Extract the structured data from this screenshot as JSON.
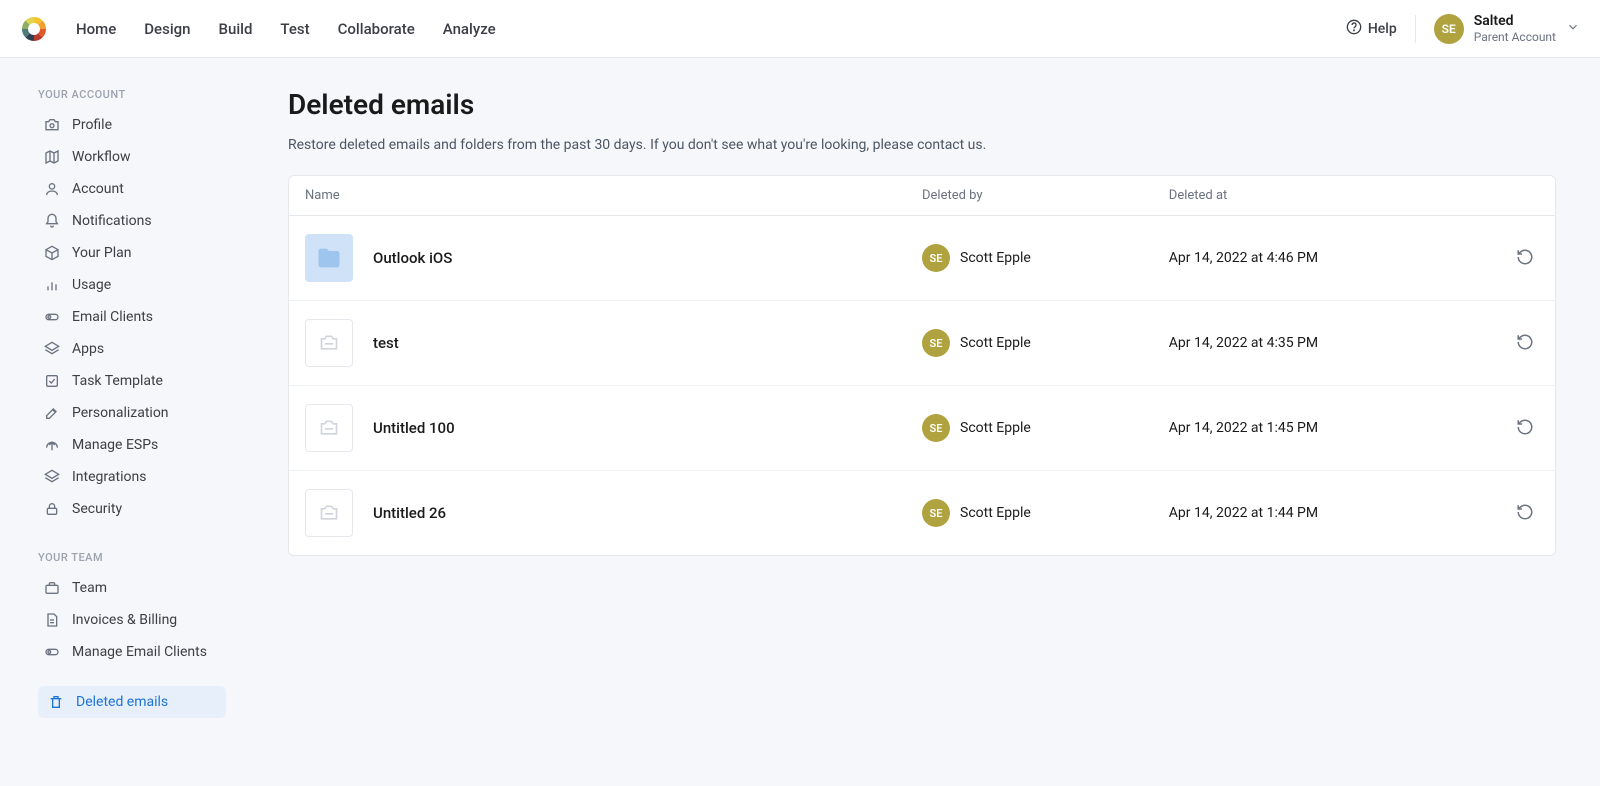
{
  "nav": {
    "items": [
      "Home",
      "Design",
      "Build",
      "Test",
      "Collaborate",
      "Analyze"
    ]
  },
  "help_label": "Help",
  "account": {
    "initials": "SE",
    "name": "Salted",
    "sub": "Parent Account"
  },
  "sidebar": {
    "sections": [
      {
        "title": "YOUR ACCOUNT",
        "items": [
          {
            "label": "Profile",
            "icon": "camera"
          },
          {
            "label": "Workflow",
            "icon": "map"
          },
          {
            "label": "Account",
            "icon": "user"
          },
          {
            "label": "Notifications",
            "icon": "bell"
          },
          {
            "label": "Your Plan",
            "icon": "box"
          },
          {
            "label": "Usage",
            "icon": "bars"
          },
          {
            "label": "Email Clients",
            "icon": "toggle"
          },
          {
            "label": "Apps",
            "icon": "layers"
          },
          {
            "label": "Task Template",
            "icon": "checksquare"
          },
          {
            "label": "Personalization",
            "icon": "edit"
          },
          {
            "label": "Manage ESPs",
            "icon": "upload"
          },
          {
            "label": "Integrations",
            "icon": "layers"
          },
          {
            "label": "Security",
            "icon": "lock"
          }
        ]
      },
      {
        "title": "YOUR TEAM",
        "items": [
          {
            "label": "Team",
            "icon": "briefcase"
          },
          {
            "label": "Invoices & Billing",
            "icon": "file"
          },
          {
            "label": "Manage Email Clients",
            "icon": "toggle"
          }
        ]
      }
    ],
    "active": {
      "label": "Deleted emails",
      "icon": "trash"
    }
  },
  "page": {
    "title": "Deleted emails",
    "description": "Restore deleted emails and folders from the past 30 days. If you don't see what you're looking, please contact us."
  },
  "table": {
    "headers": {
      "name": "Name",
      "deleted_by": "Deleted by",
      "deleted_at": "Deleted at"
    },
    "rows": [
      {
        "type": "folder",
        "name": "Outlook iOS",
        "user_initials": "SE",
        "user_name": "Scott Epple",
        "deleted_at": "Apr 14, 2022 at 4:46 PM"
      },
      {
        "type": "file",
        "name": "test",
        "user_initials": "SE",
        "user_name": "Scott Epple",
        "deleted_at": "Apr 14, 2022 at 4:35 PM"
      },
      {
        "type": "file",
        "name": "Untitled 100",
        "user_initials": "SE",
        "user_name": "Scott Epple",
        "deleted_at": "Apr 14, 2022 at 1:45 PM"
      },
      {
        "type": "file",
        "name": "Untitled 26",
        "user_initials": "SE",
        "user_name": "Scott Epple",
        "deleted_at": "Apr 14, 2022 at 1:44 PM"
      }
    ]
  }
}
